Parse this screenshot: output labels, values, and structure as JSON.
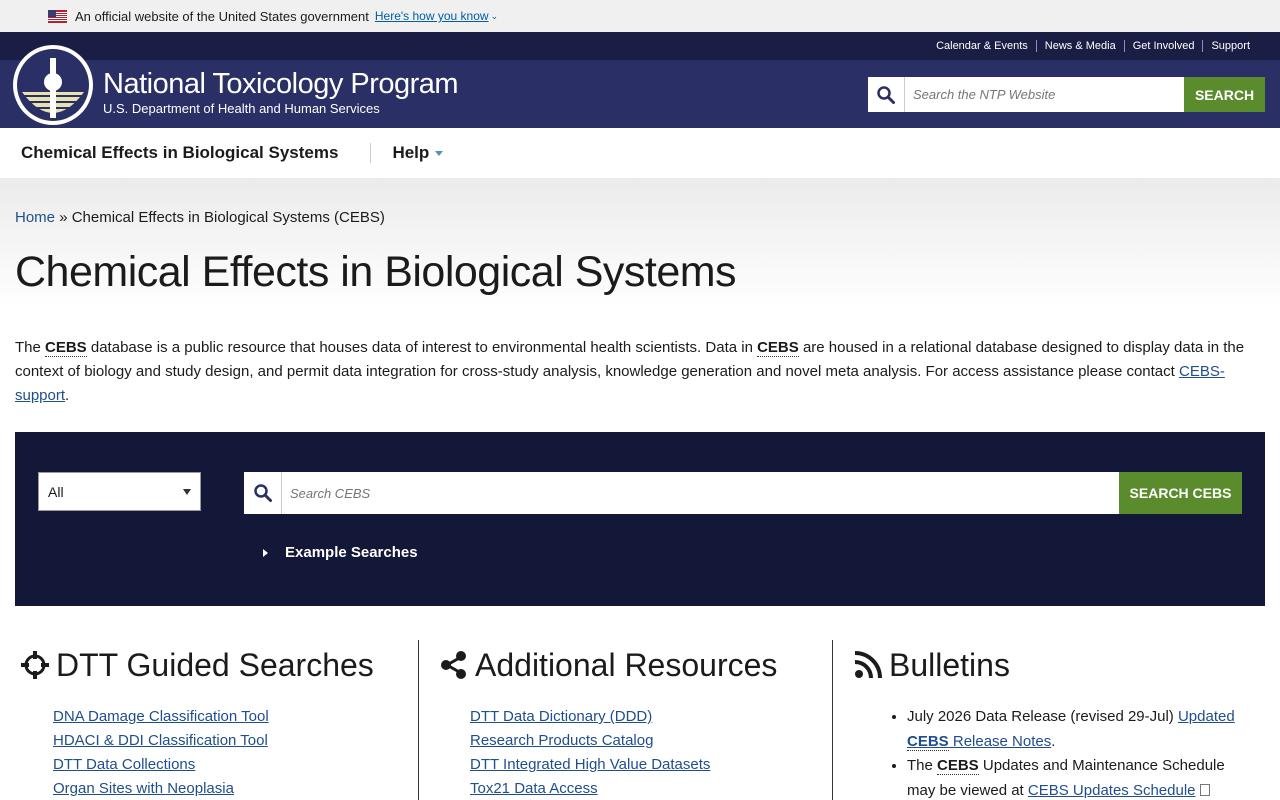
{
  "gov_banner": {
    "text": "An official website of the United States government",
    "link": "Here's how you know"
  },
  "utility_nav": [
    "Calendar & Events",
    "News & Media",
    "Get Involved",
    "Support"
  ],
  "brand": {
    "title": "National Toxicology Program",
    "subtitle": "U.S. Department of Health and Human Services"
  },
  "ntp_search": {
    "placeholder": "Search the NTP Website",
    "button": "SEARCH"
  },
  "main_nav": {
    "item1": "Chemical Effects in Biological Systems",
    "item2": "Help"
  },
  "breadcrumb": {
    "home": "Home",
    "separator": "»",
    "current": "Chemical Effects in Biological Systems (CEBS)"
  },
  "page_title": "Chemical Effects in Biological Systems",
  "intro": {
    "p1": "The ",
    "abbr1": "CEBS",
    "p2": " database is a public resource that houses data of interest to environmental health scientists. Data in ",
    "abbr2": "CEBS",
    "p3": " are housed in a relational database designed to display data in the context of biology and study design, and permit data integration for cross-study analysis, knowledge generation and novel meta analysis. For access assistance please contact ",
    "link": "CEBS-support",
    "end": "."
  },
  "cebs_search": {
    "select_value": "All",
    "placeholder": "Search CEBS",
    "button": "SEARCH CEBS",
    "example_toggle": "Example Searches"
  },
  "columns": {
    "dtt": {
      "title": "DTT Guided Searches",
      "links": [
        "DNA Damage Classification Tool",
        "HDACI & DDI Classification Tool",
        "DTT Data Collections",
        "Organ Sites with Neoplasia"
      ]
    },
    "resources": {
      "title": "Additional Resources",
      "links": [
        "DTT Data Dictionary (DDD)",
        "Research Products Catalog",
        "DTT Integrated High Value Datasets",
        "Tox21 Data Access"
      ]
    },
    "bulletins": {
      "title": "Bulletins",
      "b1_text": "July 2026 Data Release (revised 29-Jul) ",
      "b1_link1": "Updated",
      "b1_abbr": "CEBS",
      "b1_link2": " Release Notes",
      "b1_end": ".",
      "b2_text1": "The ",
      "b2_abbr": "CEBS",
      "b2_text2": " Updates and Maintenance Schedule may be viewed at ",
      "b2_link": "CEBS Updates Schedule"
    }
  },
  "colors": {
    "header": "#2a2f66",
    "topbar": "#1b1e44",
    "panel": "#141838",
    "accent_green": "#5a8c2e",
    "link": "#1f4e8c"
  }
}
